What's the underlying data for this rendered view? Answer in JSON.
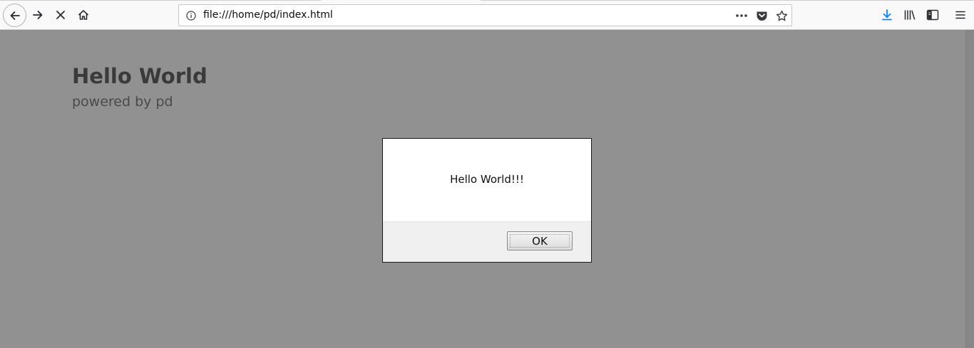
{
  "browser": {
    "url": "file:///home/pd/index.html",
    "icons": {
      "back": "back-arrow-icon",
      "forward": "forward-arrow-icon",
      "stop": "stop-icon",
      "home": "home-icon",
      "info": "info-icon",
      "page_actions": "more-icon",
      "pocket": "pocket-icon",
      "bookmark": "star-icon",
      "downloads": "download-icon",
      "library": "library-icon",
      "sidebar": "sidebar-icon",
      "menu": "hamburger-menu-icon"
    },
    "accent_color": "#0a84ff"
  },
  "page": {
    "title": "Hello World",
    "subtitle": "powered by pd"
  },
  "dialog": {
    "message": "Hello World!!!",
    "ok_label": "OK"
  }
}
